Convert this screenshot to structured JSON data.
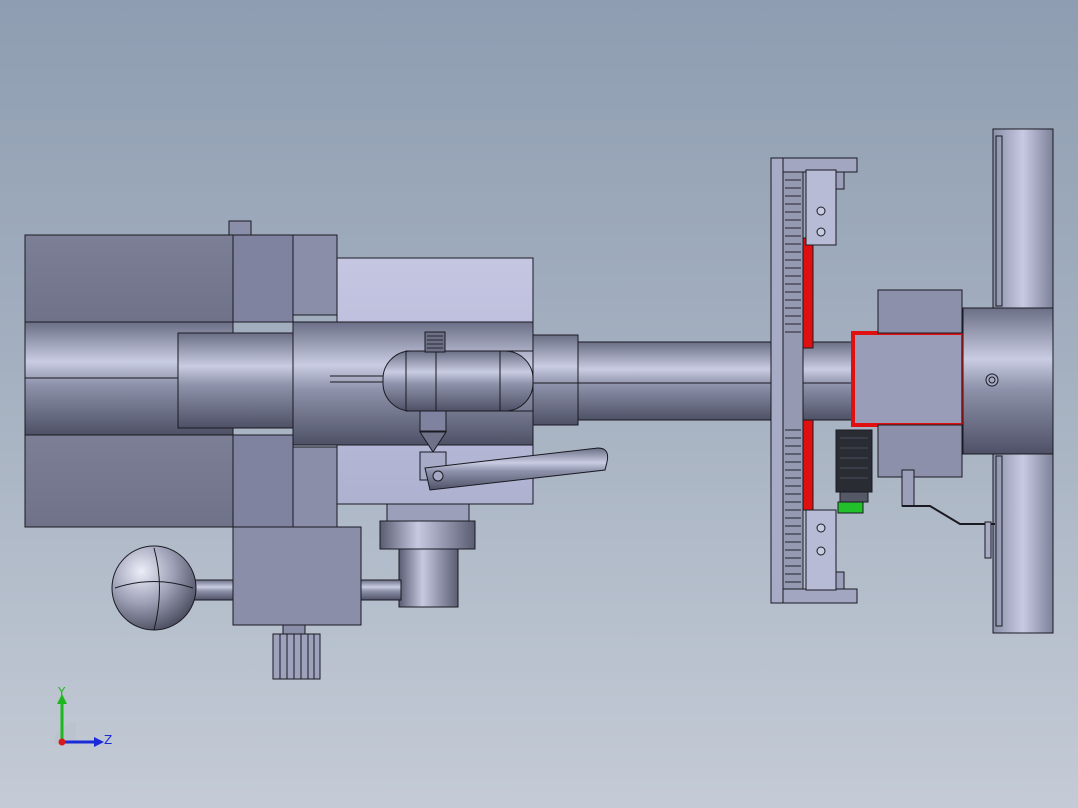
{
  "colors": {
    "background_top": "#8e9db1",
    "background_bottom": "#c4cbd6",
    "part_fill": "#9a9fb8",
    "highlight_red": "#e01010",
    "green_part": "#22c02a",
    "outline": "#1a1a22"
  },
  "triad": {
    "y_label": "Y",
    "z_label": "Z",
    "y_color": "#1db81d",
    "z_color": "#1a2ad8",
    "x_color": "#d81a1a"
  }
}
